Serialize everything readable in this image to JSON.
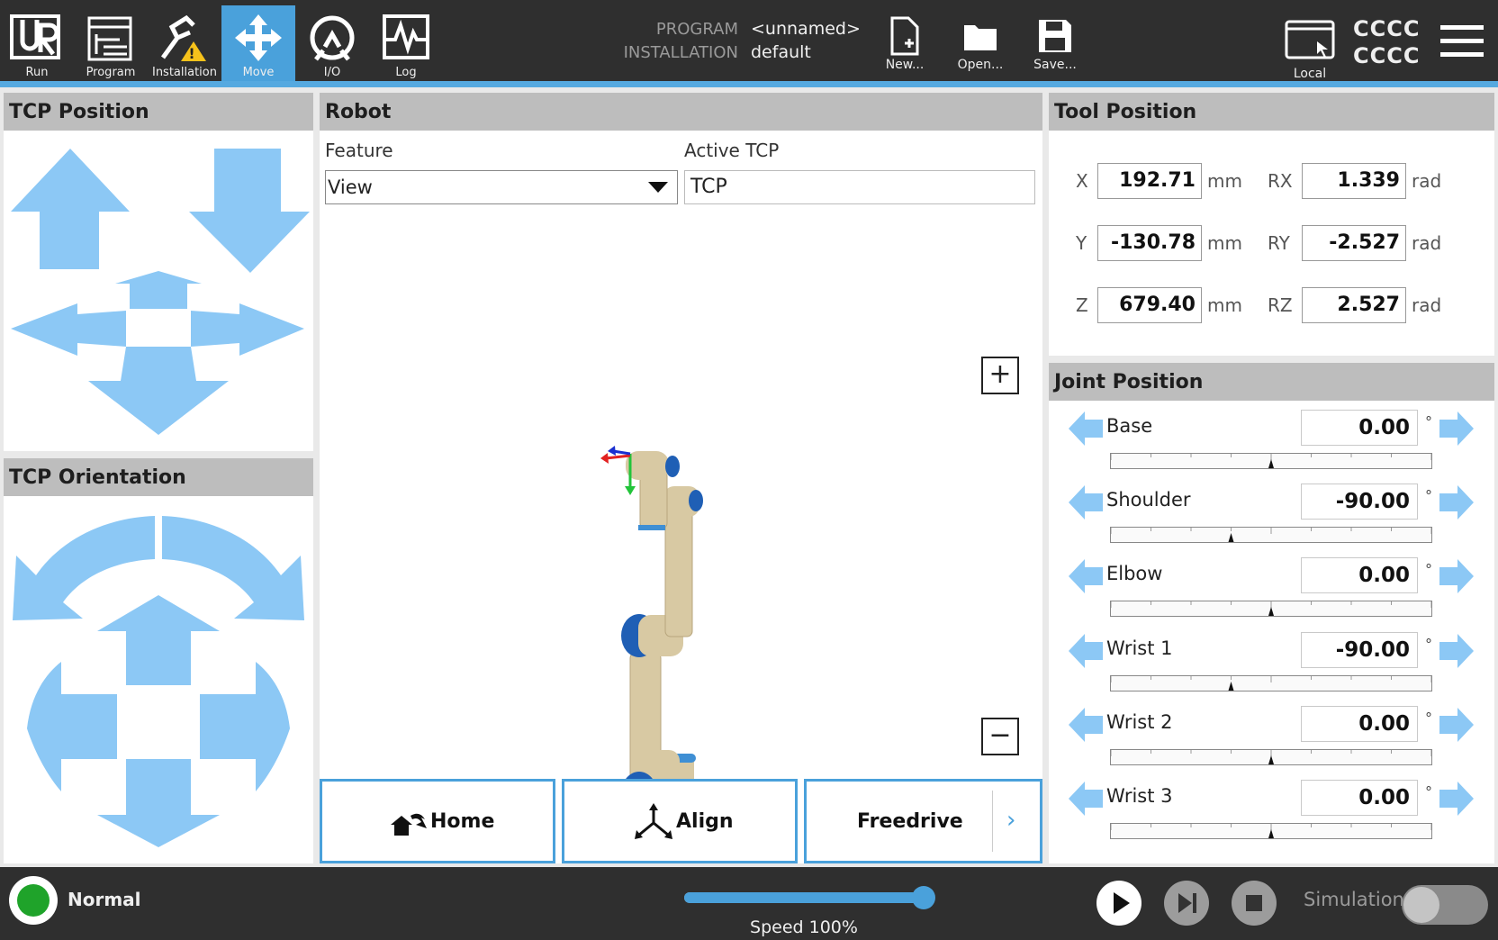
{
  "header": {
    "nav": [
      {
        "label": "Run",
        "icon": "ur-logo-icon"
      },
      {
        "label": "Program",
        "icon": "program-icon"
      },
      {
        "label": "Installation",
        "icon": "installation-warning-icon"
      },
      {
        "label": "Move",
        "icon": "move-arrows-icon",
        "active": true
      },
      {
        "label": "I/O",
        "icon": "io-icon"
      },
      {
        "label": "Log",
        "icon": "log-icon"
      }
    ],
    "program_label": "PROGRAM",
    "program_value": "<unnamed>",
    "installation_label": "INSTALLATION",
    "installation_value": "default",
    "file_buttons": [
      {
        "label": "New...",
        "icon": "new-file-icon"
      },
      {
        "label": "Open...",
        "icon": "open-folder-icon"
      },
      {
        "label": "Save...",
        "icon": "save-disk-icon"
      }
    ],
    "local_label": "Local",
    "user_line1": "CCCC",
    "user_line2": "CCCC",
    "accent_color": "#4aa1db"
  },
  "tcp_position": {
    "title": "TCP Position"
  },
  "tcp_orientation": {
    "title": "TCP Orientation"
  },
  "robot": {
    "title": "Robot",
    "feature_label": "Feature",
    "feature_value": "View",
    "active_tcp_label": "Active TCP",
    "active_tcp_value": "TCP",
    "zoom_in": "+",
    "zoom_out": "−",
    "zoom_level": 0.5,
    "home_label": "Home",
    "align_label": "Align",
    "freedrive_label": "Freedrive",
    "freedrive_chevron": "›"
  },
  "tool_position": {
    "title": "Tool Position",
    "rows": [
      {
        "axis": "X",
        "value": "192.71",
        "unit": "mm",
        "raxis": "RX",
        "rvalue": "1.339",
        "runit": "rad"
      },
      {
        "axis": "Y",
        "value": "-130.78",
        "unit": "mm",
        "raxis": "RY",
        "rvalue": "-2.527",
        "runit": "rad"
      },
      {
        "axis": "Z",
        "value": "679.40",
        "unit": "mm",
        "raxis": "RZ",
        "rvalue": "2.527",
        "runit": "rad"
      }
    ]
  },
  "joint_position": {
    "title": "Joint Position",
    "degree_symbol": "°",
    "joints": [
      {
        "name": "Base",
        "value": "0.00",
        "fraction": 0.5
      },
      {
        "name": "Shoulder",
        "value": "-90.00",
        "fraction": 0.375
      },
      {
        "name": "Elbow",
        "value": "0.00",
        "fraction": 0.5
      },
      {
        "name": "Wrist 1",
        "value": "-90.00",
        "fraction": 0.375
      },
      {
        "name": "Wrist 2",
        "value": "0.00",
        "fraction": 0.5
      },
      {
        "name": "Wrist 3",
        "value": "0.00",
        "fraction": 0.5
      }
    ]
  },
  "footer": {
    "status_label": "Normal",
    "status_color": "#1fa32a",
    "speed_label": "Speed 100%",
    "speed_fraction": 1.0,
    "simulation_label": "Simulation"
  }
}
